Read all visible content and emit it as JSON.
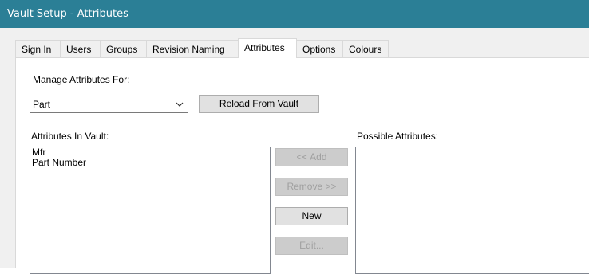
{
  "window": {
    "title": "Vault Setup - Attributes"
  },
  "tabs": [
    {
      "label": "Sign In",
      "active": false
    },
    {
      "label": "Users",
      "active": false
    },
    {
      "label": "Groups",
      "active": false
    },
    {
      "label": "Revision Naming",
      "active": false
    },
    {
      "label": "Attributes",
      "active": true
    },
    {
      "label": "Options",
      "active": false
    },
    {
      "label": "Colours",
      "active": false
    }
  ],
  "attributes_page": {
    "manage_label": "Manage Attributes For:",
    "manage_selected": "Part",
    "reload_button": "Reload From Vault",
    "in_vault_label": "Attributes In Vault:",
    "in_vault_items": [
      "Mfr",
      "Part Number"
    ],
    "possible_label": "Possible Attributes:",
    "possible_items": [],
    "add_button": "<< Add",
    "remove_button": "Remove >>",
    "new_button": "New",
    "edit_button": "Edit..."
  },
  "colors": {
    "titlebar": "#2b7f96",
    "dialog_bg": "#f0f0f0",
    "disabled_text": "#a0a0a0"
  }
}
